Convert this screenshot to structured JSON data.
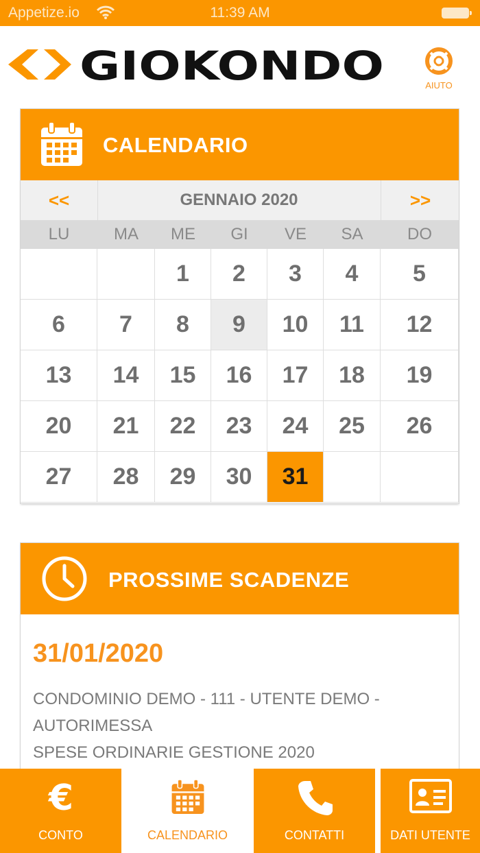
{
  "status_bar": {
    "carrier": "Appetize.io",
    "time": "11:39 AM"
  },
  "header": {
    "logo_text": "GIOKONDO",
    "help_label": "AIUTO"
  },
  "calendar": {
    "title": "CALENDARIO",
    "prev_label": "<<",
    "next_label": ">>",
    "month_label": "GENNAIO 2020",
    "weekdays": [
      "LU",
      "MA",
      "ME",
      "GI",
      "VE",
      "SA",
      "DO"
    ],
    "weeks": [
      [
        "",
        "",
        "1",
        "2",
        "3",
        "4",
        "5"
      ],
      [
        "6",
        "7",
        "8",
        "9",
        "10",
        "11",
        "12"
      ],
      [
        "13",
        "14",
        "15",
        "16",
        "17",
        "18",
        "19"
      ],
      [
        "20",
        "21",
        "22",
        "23",
        "24",
        "25",
        "26"
      ],
      [
        "27",
        "28",
        "29",
        "30",
        "31",
        "",
        ""
      ]
    ],
    "today": "9",
    "selected": "31"
  },
  "deadlines": {
    "title": "PROSSIME SCADENZE",
    "date": "31/01/2020",
    "lines": [
      "CONDOMINIO DEMO - 111 - UTENTE DEMO -",
      "AUTORIMESSA",
      "SPESE ORDINARIE GESTIONE 2020"
    ]
  },
  "tabs": [
    {
      "label": "CONTO",
      "icon": "euro-icon",
      "active": false
    },
    {
      "label": "CALENDARIO",
      "icon": "calendar-icon",
      "active": true
    },
    {
      "label": "CONTATTI",
      "icon": "phone-icon",
      "active": false
    },
    {
      "label": "DATI UTENTE",
      "icon": "id-card-icon",
      "active": false
    }
  ],
  "colors": {
    "accent": "#fb9600",
    "accent_text": "#f7931e",
    "text_gray": "#6f6f6f"
  }
}
